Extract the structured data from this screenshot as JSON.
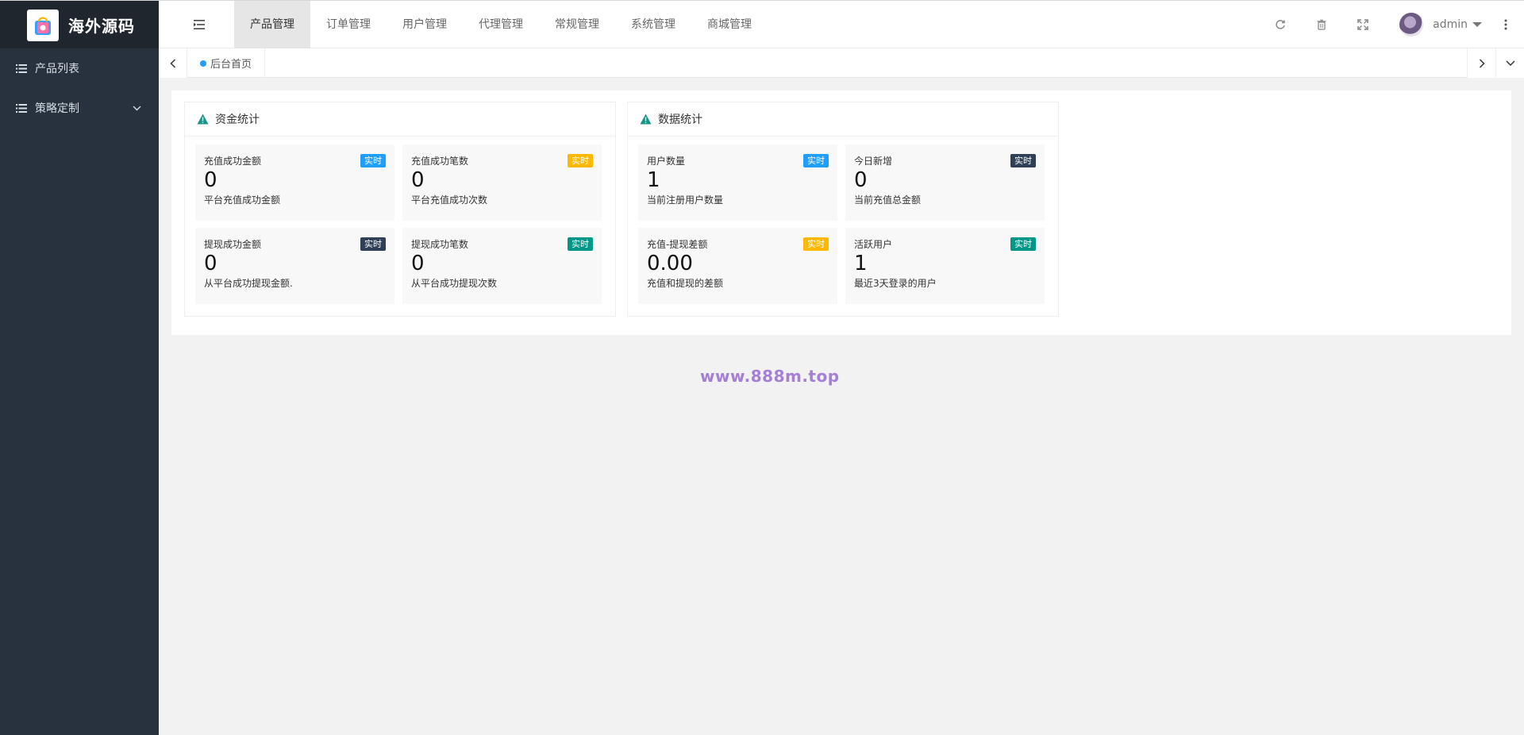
{
  "app": {
    "logo_text": "海外源码"
  },
  "top_nav": [
    {
      "label": "产品管理",
      "active": true
    },
    {
      "label": "订单管理",
      "active": false
    },
    {
      "label": "用户管理",
      "active": false
    },
    {
      "label": "代理管理",
      "active": false
    },
    {
      "label": "常规管理",
      "active": false
    },
    {
      "label": "系统管理",
      "active": false
    },
    {
      "label": "商城管理",
      "active": false
    }
  ],
  "user": {
    "name": "admin"
  },
  "sidebar": {
    "items": [
      {
        "label": "产品列表",
        "icon": "list-icon",
        "has_submenu": false
      },
      {
        "label": "策略定制",
        "icon": "list-icon",
        "has_submenu": true
      }
    ]
  },
  "tabs": [
    {
      "label": "后台首页",
      "active": true
    }
  ],
  "cards": [
    {
      "title": "资金统计",
      "stats": [
        {
          "label": "充值成功金额",
          "value": "0",
          "desc": "平台充值成功金额",
          "badge": "实时",
          "badge_color": "#1e9fff"
        },
        {
          "label": "充值成功笔数",
          "value": "0",
          "desc": "平台充值成功次数",
          "badge": "实时",
          "badge_color": "#ffb800"
        },
        {
          "label": "提现成功金额",
          "value": "0",
          "desc": "从平台成功提现金额.",
          "badge": "实时",
          "badge_color": "#2f4056"
        },
        {
          "label": "提现成功笔数",
          "value": "0",
          "desc": "从平台成功提现次数",
          "badge": "实时",
          "badge_color": "#009688"
        }
      ]
    },
    {
      "title": "数据统计",
      "stats": [
        {
          "label": "用户数量",
          "value": "1",
          "desc": "当前注册用户数量",
          "badge": "实时",
          "badge_color": "#1e9fff"
        },
        {
          "label": "今日新增",
          "value": "0",
          "desc": "当前充值总金额",
          "badge": "实时",
          "badge_color": "#2f4056"
        },
        {
          "label": "充值-提现差额",
          "value": "0.00",
          "desc": "充值和提现的差额",
          "badge": "实时",
          "badge_color": "#ffb800"
        },
        {
          "label": "活跃用户",
          "value": "1",
          "desc": "最近3天登录的用户",
          "badge": "实时",
          "badge_color": "#009688"
        }
      ]
    }
  ],
  "watermark": "www.888m.top",
  "colors": {
    "sidebar_bg": "#28323e",
    "logo_bg": "#20262e",
    "accent": "#1e9fff",
    "warning_icon": "#009688"
  }
}
